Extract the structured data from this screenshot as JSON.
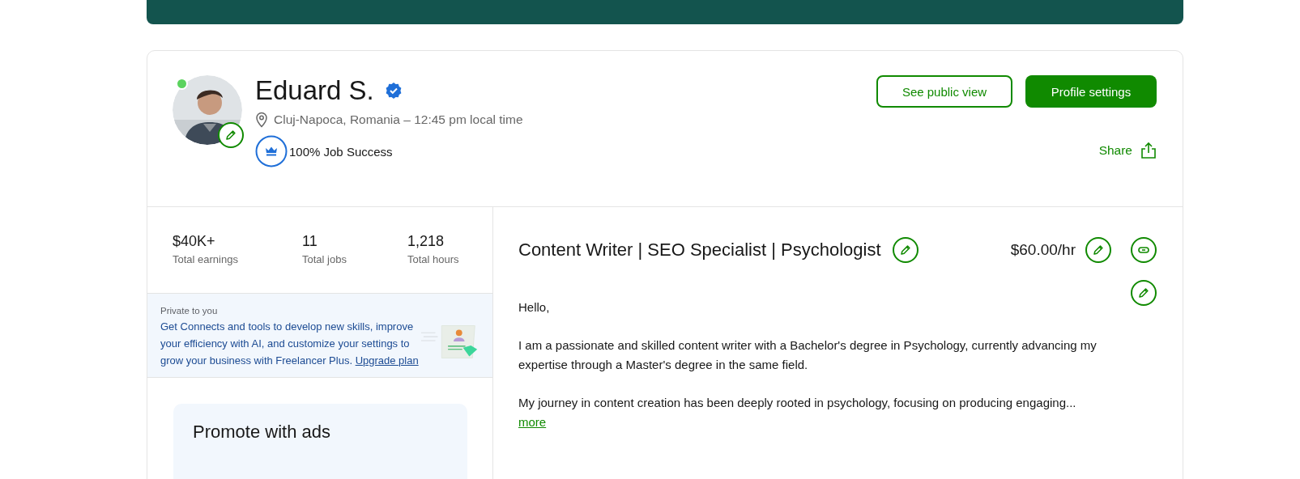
{
  "profile": {
    "name": "Eduard S.",
    "verified": true,
    "online": true,
    "location": "Cluj-Napoca, Romania – 12:45 pm local time",
    "job_success": "100% Job Success"
  },
  "actions": [
    {
      "label": "See public view",
      "kind": "outline"
    },
    {
      "label": "Profile settings",
      "kind": "primary"
    }
  ],
  "share": "Share",
  "stats": [
    {
      "value": "$40K+",
      "label": "Total earnings"
    },
    {
      "value": "11",
      "label": "Total jobs"
    },
    {
      "value": "1,218",
      "label": "Total hours"
    }
  ],
  "promo": {
    "eyebrow": "Private to you",
    "text": "Get Connects and tools to develop new skills, improve your efficiency with AI, and customize your settings to grow your business with Freelancer Plus.",
    "link": "Upgrade plan"
  },
  "ads": {
    "title": "Promote with ads"
  },
  "headline": "Content Writer | SEO Specialist | Psychologist",
  "rate": "$60.00/hr",
  "bio": [
    "Hello,",
    "I am a passionate and skilled content writer with a Bachelor's degree in Psychology, currently advancing my expertise through a Master's degree in the same field.",
    "My journey in content creation has been deeply rooted in psychology, focusing on producing engaging..."
  ],
  "more": "more"
}
